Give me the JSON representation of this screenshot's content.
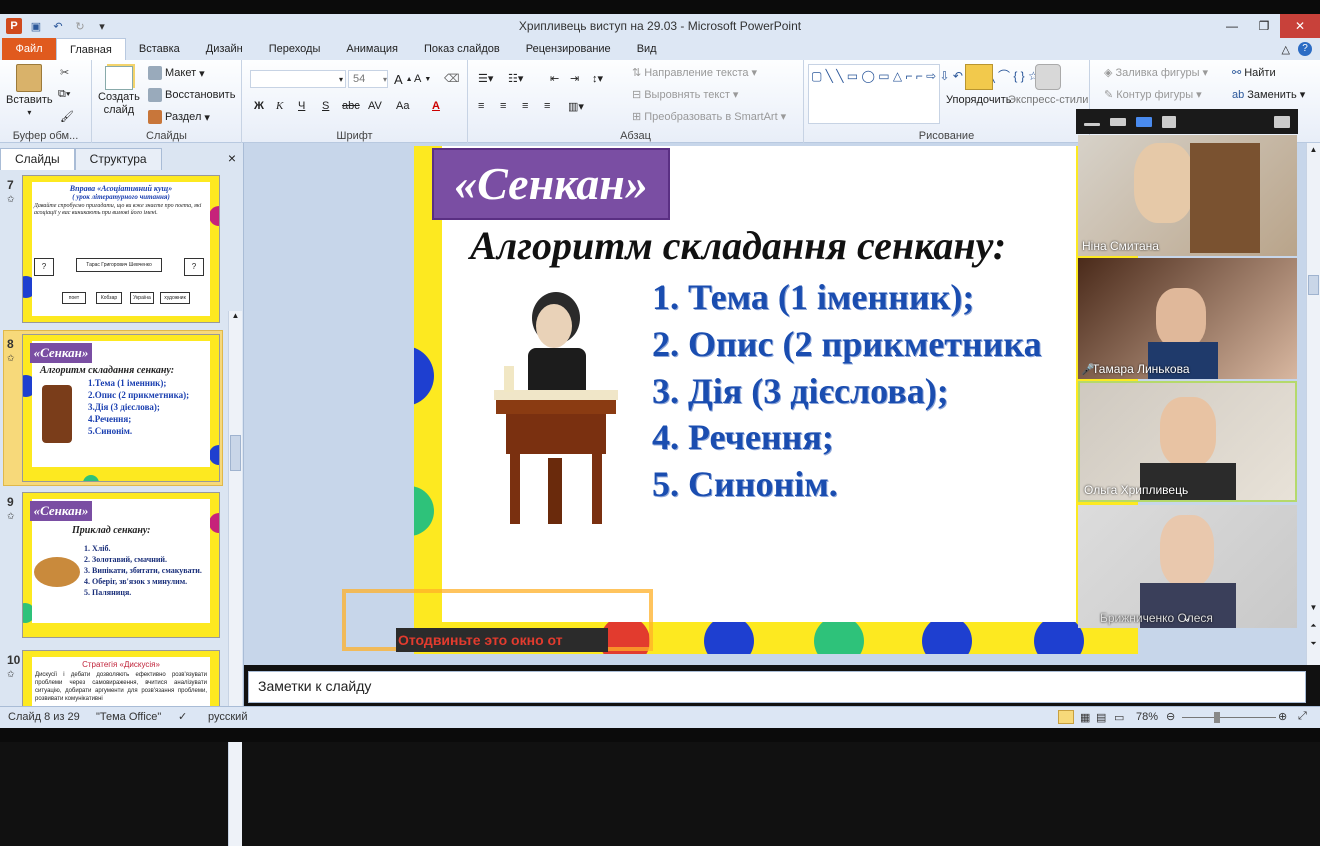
{
  "window": {
    "title": "Хрипливець виступ на 29.03 - Microsoft PowerPoint"
  },
  "tabs": [
    "Файл",
    "Главная",
    "Вставка",
    "Дизайн",
    "Переходы",
    "Анимация",
    "Показ слайдов",
    "Рецензирование",
    "Вид"
  ],
  "ribbon": {
    "clipboard": {
      "paste": "Вставить",
      "label": "Буфер обм..."
    },
    "slides": {
      "create": "Создать",
      "create2": "слайд",
      "layout": "Макет",
      "restore": "Восстановить",
      "section": "Раздел",
      "label": "Слайды"
    },
    "font": {
      "size": "54",
      "label": "Шрифт",
      "bold": "Ж",
      "italic": "К",
      "underline": "Ч",
      "strike": "S",
      "abc": "abc",
      "spacing": "AV",
      "case": "Aa"
    },
    "paragraph": {
      "direction": "Направление текста",
      "align": "Выровнять текст",
      "smartart": "Преобразовать в SmartArt",
      "label": "Абзац"
    },
    "drawing": {
      "arrange": "Упорядочить",
      "styles": "Экспресс-стили",
      "fill": "Заливка фигуры",
      "outline": "Контур фигуры",
      "label": "Рисование"
    },
    "editing": {
      "find": "Найти",
      "replace": "Заменить"
    }
  },
  "panel": {
    "tab_slides": "Слайды",
    "tab_outline": "Структура",
    "close": "×"
  },
  "thumbnails": [
    {
      "num": "7",
      "title": "Вправа «Асоціативний кущ»",
      "subtitle": "( урок літературного читання)",
      "text": "Давайте спробуємо пригадати, що ви вже знаєте про поета, які асоціації у вас виникають при вимові його імені.",
      "center": "Тарас Григорович Шевченко",
      "q": "?",
      "boxes": [
        "поет",
        "Кобзар",
        "Україна",
        "художник"
      ]
    },
    {
      "num": "8",
      "badge": "«Сенкан»",
      "title": "Алгоритм складання сенкану:",
      "items": [
        "1.Тема (1 іменник);",
        "2.Опис (2 прикметника);",
        "3.Дія (3 дієслова);",
        "4.Речення;",
        "5.Синонім."
      ]
    },
    {
      "num": "9",
      "badge": "«Сенкан»",
      "title": "Приклад сенкану:",
      "items": [
        "1. Хліб.",
        "2. Золотавий, смачний.",
        "3. Випікати, збитати, смакувати.",
        "4. Оберіг, зв'язок з минулим.",
        "5. Паляниця."
      ]
    },
    {
      "num": "10",
      "title": "Стратегія «Дискусія»",
      "text": "Дискусії і дебати дозволяють ефективно розв'язувати проблеми через самовираження, вчитися аналізувати ситуацію, добирати аргументи для розв'язання проблеми, розвивати комунікативні"
    }
  ],
  "slide": {
    "badge": "«Сенкан»",
    "heading": "Алгоритм складання сенкану:",
    "items": [
      "1. Тема (1 іменник);",
      "2. Опис (2 прикметника",
      "3. Дія (3 дієслова);",
      "4. Речення;",
      "5. Синонім."
    ]
  },
  "notes": {
    "placeholder": "Заметки к слайду"
  },
  "overlay": {
    "text": "Отодвиньте это окно от"
  },
  "status": {
    "slide": "Слайд 8 из 29",
    "theme": "\"Тема Office\"",
    "lang": "русский",
    "zoom": "78%"
  },
  "participants": [
    {
      "name": "Ніна Смитана",
      "muted": false
    },
    {
      "name": "Тамара Линькова",
      "muted": true
    },
    {
      "name": "Ольга Хрипливець",
      "muted": false
    },
    {
      "name": "Брижниченко Олеся",
      "muted": false
    }
  ],
  "colors": {
    "accent": "#e05a1e",
    "ribbon_bg": "#dde7f4",
    "slide_yellow": "#fde920",
    "slide_purple": "#7a4ea3",
    "item_blue": "#1a4db0",
    "active_speaker": "#b5d96b"
  }
}
